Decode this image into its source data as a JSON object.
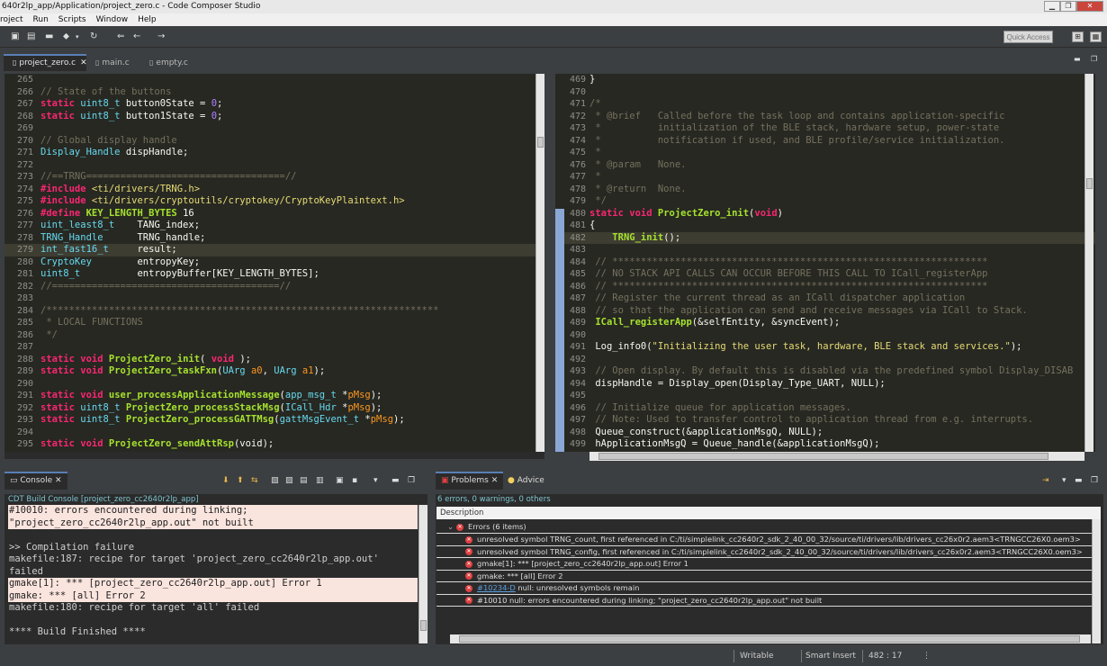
{
  "window": {
    "title": "640r2lp_app/Application/project_zero.c - Code Composer Studio",
    "minimize": "▁",
    "maximize": "❐",
    "close": "✕"
  },
  "menu": [
    "roject",
    "Run",
    "Scripts",
    "Window",
    "Help"
  ],
  "toolbar": {
    "quick_access_placeholder": "Quick Access"
  },
  "editor_tabs": [
    {
      "label": "project_zero.c",
      "active": true
    },
    {
      "label": "main.c",
      "active": false
    },
    {
      "label": "empty.c",
      "active": false
    }
  ],
  "left_editor": {
    "lines": [
      {
        "n": "265",
        "t": [
          [
            "pl",
            ""
          ]
        ]
      },
      {
        "n": "266",
        "t": [
          [
            "com",
            "// State of the buttons"
          ]
        ]
      },
      {
        "n": "267",
        "t": [
          [
            "kw",
            "static"
          ],
          [
            "pl",
            " "
          ],
          [
            "ty",
            "uint8_t"
          ],
          [
            "pl",
            " button0State = "
          ],
          [
            "num",
            "0"
          ],
          [
            "pl",
            ";"
          ]
        ]
      },
      {
        "n": "268",
        "t": [
          [
            "kw",
            "static"
          ],
          [
            "pl",
            " "
          ],
          [
            "ty",
            "uint8_t"
          ],
          [
            "pl",
            " button1State = "
          ],
          [
            "num",
            "0"
          ],
          [
            "pl",
            ";"
          ]
        ]
      },
      {
        "n": "269",
        "t": [
          [
            "pl",
            ""
          ]
        ]
      },
      {
        "n": "270",
        "t": [
          [
            "com",
            "// Global display handle"
          ]
        ]
      },
      {
        "n": "271",
        "t": [
          [
            "ty",
            "Display_Handle"
          ],
          [
            "pl",
            " dispHandle;"
          ]
        ]
      },
      {
        "n": "272",
        "t": [
          [
            "pl",
            ""
          ]
        ]
      },
      {
        "n": "273",
        "t": [
          [
            "com",
            "//==TRNG===================================//"
          ]
        ]
      },
      {
        "n": "274",
        "t": [
          [
            "inc",
            "#include"
          ],
          [
            "pl",
            " "
          ],
          [
            "str",
            "<ti/drivers/TRNG.h>"
          ]
        ]
      },
      {
        "n": "275",
        "t": [
          [
            "inc",
            "#include"
          ],
          [
            "pl",
            " "
          ],
          [
            "str",
            "<ti/drivers/cryptoutils/cryptokey/CryptoKeyPlaintext.h>"
          ]
        ]
      },
      {
        "n": "276",
        "t": [
          [
            "inc",
            "#define"
          ],
          [
            "pl",
            " "
          ],
          [
            "fn",
            "KEY_LENGTH_BYTES"
          ],
          [
            "pl",
            " 16"
          ]
        ]
      },
      {
        "n": "277",
        "t": [
          [
            "ty",
            "uint_least8_t"
          ],
          [
            "pl",
            "    TANG_index;"
          ]
        ]
      },
      {
        "n": "278",
        "t": [
          [
            "ty",
            "TRNG_Handle"
          ],
          [
            "pl",
            "      TRNG_handle;"
          ]
        ]
      },
      {
        "n": "279",
        "t": [
          [
            "ty",
            "int_fast16_t"
          ],
          [
            "pl",
            "     result;"
          ]
        ],
        "cur": true
      },
      {
        "n": "280",
        "t": [
          [
            "ty",
            "CryptoKey"
          ],
          [
            "pl",
            "        entropyKey;"
          ]
        ]
      },
      {
        "n": "281",
        "t": [
          [
            "ty",
            "uint8_t"
          ],
          [
            "pl",
            "          entropyBuffer[KEY_LENGTH_BYTES];"
          ]
        ]
      },
      {
        "n": "282",
        "t": [
          [
            "com",
            "//========================================//"
          ]
        ]
      },
      {
        "n": "283",
        "t": [
          [
            "pl",
            ""
          ]
        ]
      },
      {
        "n": "284",
        "t": [
          [
            "com",
            "/*********************************************************************"
          ]
        ]
      },
      {
        "n": "285",
        "t": [
          [
            "com",
            " * LOCAL FUNCTIONS"
          ]
        ]
      },
      {
        "n": "286",
        "t": [
          [
            "com",
            " */"
          ]
        ]
      },
      {
        "n": "287",
        "t": [
          [
            "pl",
            ""
          ]
        ]
      },
      {
        "n": "288",
        "t": [
          [
            "kw",
            "static"
          ],
          [
            "pl",
            " "
          ],
          [
            "kw",
            "void"
          ],
          [
            "pl",
            " "
          ],
          [
            "fn",
            "ProjectZero_init"
          ],
          [
            "pl",
            "( "
          ],
          [
            "kw",
            "void"
          ],
          [
            "pl",
            " );"
          ]
        ]
      },
      {
        "n": "289",
        "t": [
          [
            "kw",
            "static"
          ],
          [
            "pl",
            " "
          ],
          [
            "kw",
            "void"
          ],
          [
            "pl",
            " "
          ],
          [
            "fn",
            "ProjectZero_taskFxn"
          ],
          [
            "pl",
            "("
          ],
          [
            "ty",
            "UArg"
          ],
          [
            "pl",
            " "
          ],
          [
            "par",
            "a0"
          ],
          [
            "pl",
            ", "
          ],
          [
            "ty",
            "UArg"
          ],
          [
            "pl",
            " "
          ],
          [
            "par",
            "a1"
          ],
          [
            "pl",
            ");"
          ]
        ]
      },
      {
        "n": "290",
        "t": [
          [
            "pl",
            ""
          ]
        ]
      },
      {
        "n": "291",
        "t": [
          [
            "kw",
            "static"
          ],
          [
            "pl",
            " "
          ],
          [
            "kw",
            "void"
          ],
          [
            "pl",
            " "
          ],
          [
            "fn",
            "user_processApplicationMessage"
          ],
          [
            "pl",
            "("
          ],
          [
            "ty",
            "app_msg_t"
          ],
          [
            "pl",
            " *"
          ],
          [
            "par",
            "pMsg"
          ],
          [
            "pl",
            ");"
          ]
        ]
      },
      {
        "n": "292",
        "t": [
          [
            "kw",
            "static"
          ],
          [
            "pl",
            " "
          ],
          [
            "ty",
            "uint8_t"
          ],
          [
            "pl",
            " "
          ],
          [
            "fn",
            "ProjectZero_processStackMsg"
          ],
          [
            "pl",
            "("
          ],
          [
            "ty",
            "ICall_Hdr"
          ],
          [
            "pl",
            " *"
          ],
          [
            "par",
            "pMsg"
          ],
          [
            "pl",
            ");"
          ]
        ]
      },
      {
        "n": "293",
        "t": [
          [
            "kw",
            "static"
          ],
          [
            "pl",
            " "
          ],
          [
            "ty",
            "uint8_t"
          ],
          [
            "pl",
            " "
          ],
          [
            "fn",
            "ProjectZero_processGATTMsg"
          ],
          [
            "pl",
            "("
          ],
          [
            "ty",
            "gattMsgEvent_t"
          ],
          [
            "pl",
            " *"
          ],
          [
            "par",
            "pMsg"
          ],
          [
            "pl",
            ");"
          ]
        ]
      },
      {
        "n": "294",
        "t": [
          [
            "pl",
            ""
          ]
        ]
      },
      {
        "n": "295",
        "t": [
          [
            "kw",
            "static"
          ],
          [
            "pl",
            " "
          ],
          [
            "kw",
            "void"
          ],
          [
            "pl",
            " "
          ],
          [
            "fn",
            "ProjectZero_sendAttRsp"
          ],
          [
            "pl",
            "(void);"
          ]
        ]
      }
    ]
  },
  "right_editor": {
    "lines": [
      {
        "n": "469",
        "t": [
          [
            "pl",
            "}"
          ]
        ]
      },
      {
        "n": "470",
        "t": [
          [
            "pl",
            ""
          ]
        ]
      },
      {
        "n": "471",
        "t": [
          [
            "com",
            "/*"
          ]
        ]
      },
      {
        "n": "472",
        "t": [
          [
            "com",
            " * @brief   Called before the task loop and contains application-specific"
          ]
        ]
      },
      {
        "n": "473",
        "t": [
          [
            "com",
            " *          initialization of the BLE stack, hardware setup, power-state"
          ]
        ]
      },
      {
        "n": "474",
        "t": [
          [
            "com",
            " *          notification if used, and BLE profile/service initialization."
          ]
        ]
      },
      {
        "n": "475",
        "t": [
          [
            "com",
            " *"
          ]
        ]
      },
      {
        "n": "476",
        "t": [
          [
            "com",
            " * @param   None."
          ]
        ]
      },
      {
        "n": "477",
        "t": [
          [
            "com",
            " *"
          ]
        ]
      },
      {
        "n": "478",
        "t": [
          [
            "com",
            " * @return  None."
          ]
        ]
      },
      {
        "n": "479",
        "t": [
          [
            "com",
            " */"
          ]
        ]
      },
      {
        "n": "480",
        "t": [
          [
            "kw",
            "static"
          ],
          [
            "pl",
            " "
          ],
          [
            "kw",
            "void"
          ],
          [
            "pl",
            " "
          ],
          [
            "fn",
            "ProjectZero_init"
          ],
          [
            "pl",
            "("
          ],
          [
            "kw",
            "void"
          ],
          [
            "pl",
            ")"
          ]
        ]
      },
      {
        "n": "481",
        "t": [
          [
            "pl",
            "{"
          ]
        ]
      },
      {
        "n": "482",
        "t": [
          [
            "pl",
            "    "
          ],
          [
            "fn",
            "TRNG_init"
          ],
          [
            "pl",
            "();"
          ]
        ],
        "cur": true
      },
      {
        "n": "483",
        "t": [
          [
            "pl",
            ""
          ]
        ]
      },
      {
        "n": "484",
        "t": [
          [
            "com",
            " // ******************************************************************"
          ]
        ]
      },
      {
        "n": "485",
        "t": [
          [
            "com",
            " // NO STACK API CALLS CAN OCCUR BEFORE THIS CALL TO ICall_registerApp"
          ]
        ]
      },
      {
        "n": "486",
        "t": [
          [
            "com",
            " // ******************************************************************"
          ]
        ]
      },
      {
        "n": "487",
        "t": [
          [
            "com",
            " // Register the current thread as an ICall dispatcher application"
          ]
        ]
      },
      {
        "n": "488",
        "t": [
          [
            "com",
            " // so that the application can send and receive messages via ICall to Stack."
          ]
        ]
      },
      {
        "n": "489",
        "t": [
          [
            "pl",
            " "
          ],
          [
            "fn",
            "ICall_registerApp"
          ],
          [
            "pl",
            "(&selfEntity, &syncEvent);"
          ]
        ]
      },
      {
        "n": "490",
        "t": [
          [
            "pl",
            ""
          ]
        ]
      },
      {
        "n": "491",
        "t": [
          [
            "pl",
            " Log_info0("
          ],
          [
            "str",
            "\"Initializing the user task, hardware, BLE stack and services.\""
          ],
          [
            "pl",
            ");"
          ]
        ]
      },
      {
        "n": "492",
        "t": [
          [
            "pl",
            ""
          ]
        ]
      },
      {
        "n": "493",
        "t": [
          [
            "com",
            " // Open display. By default this is disabled via the predefined symbol Display_DISAB"
          ]
        ]
      },
      {
        "n": "494",
        "t": [
          [
            "pl",
            " dispHandle = Display_open(Display_Type_UART, NULL);"
          ]
        ]
      },
      {
        "n": "495",
        "t": [
          [
            "pl",
            ""
          ]
        ]
      },
      {
        "n": "496",
        "t": [
          [
            "com",
            " // Initialize queue for application messages."
          ]
        ]
      },
      {
        "n": "497",
        "t": [
          [
            "com",
            " // Note: Used to transfer control to application thread from e.g. interrupts."
          ]
        ]
      },
      {
        "n": "498",
        "t": [
          [
            "pl",
            " Queue_construct(&applicationMsgQ, NULL);"
          ]
        ]
      },
      {
        "n": "499",
        "t": [
          [
            "pl",
            " hApplicationMsgQ = Queue_handle(&applicationMsgQ);"
          ]
        ]
      }
    ]
  },
  "console": {
    "tab_label": "Console",
    "title": "CDT Build Console [project_zero_cc2640r2lp_app]",
    "lines": [
      {
        "text": "#10010: errors encountered during linking;",
        "err": true
      },
      {
        "text": "\"project_zero_cc2640r2lp_app.out\" not built",
        "err": true
      },
      {
        "text": "",
        "err": false
      },
      {
        "text": ">> Compilation failure",
        "err": false
      },
      {
        "text": "makefile:187: recipe for target 'project_zero_cc2640r2lp_app.out'",
        "err": false
      },
      {
        "text": "failed",
        "err": false
      },
      {
        "text": "gmake[1]: *** [project_zero_cc2640r2lp_app.out] Error 1",
        "err": true
      },
      {
        "text": "gmake: *** [all] Error 2",
        "err": true
      },
      {
        "text": "makefile:180: recipe for target 'all' failed",
        "err": false
      },
      {
        "text": "",
        "err": false
      },
      {
        "text": "**** Build Finished ****",
        "err": false
      }
    ]
  },
  "problems": {
    "tab_label": "Problems",
    "advice_label": "Advice",
    "summary": "6 errors, 0 warnings, 0 others",
    "column": "Description",
    "group": "Errors (6 items)",
    "items": [
      {
        "link": "",
        "text": "unresolved symbol TRNG_count, first referenced in C:/ti/simplelink_cc2640r2_sdk_2_40_00_32/source/ti/drivers/lib/drivers_cc26x0r2.aem3<TRNGCC26X0.oem3>"
      },
      {
        "link": "",
        "text": "unresolved symbol TRNG_config, first referenced in C:/ti/simplelink_cc2640r2_sdk_2_40_00_32/source/ti/drivers/lib/drivers_cc26x0r2.aem3<TRNGCC26X0.oem3>"
      },
      {
        "link": "",
        "text": "gmake[1]: *** [project_zero_cc2640r2lp_app.out] Error 1"
      },
      {
        "link": "",
        "text": "gmake: *** [all] Error 2"
      },
      {
        "link": "#10234-D",
        "text": " null: unresolved symbols remain"
      },
      {
        "link": "",
        "text": "#10010 null: errors encountered during linking; \"project_zero_cc2640r2lp_app.out\" not built"
      }
    ]
  },
  "status": {
    "mode": "Writable",
    "insert": "Smart Insert",
    "position": "482 : 17"
  },
  "colors": {
    "editor_bg": "#272822",
    "keyword": "#f92672",
    "type": "#66d9ef",
    "function": "#a6e22e",
    "comment": "#75715e",
    "string": "#e6db74",
    "error_bg": "#fae4de"
  }
}
